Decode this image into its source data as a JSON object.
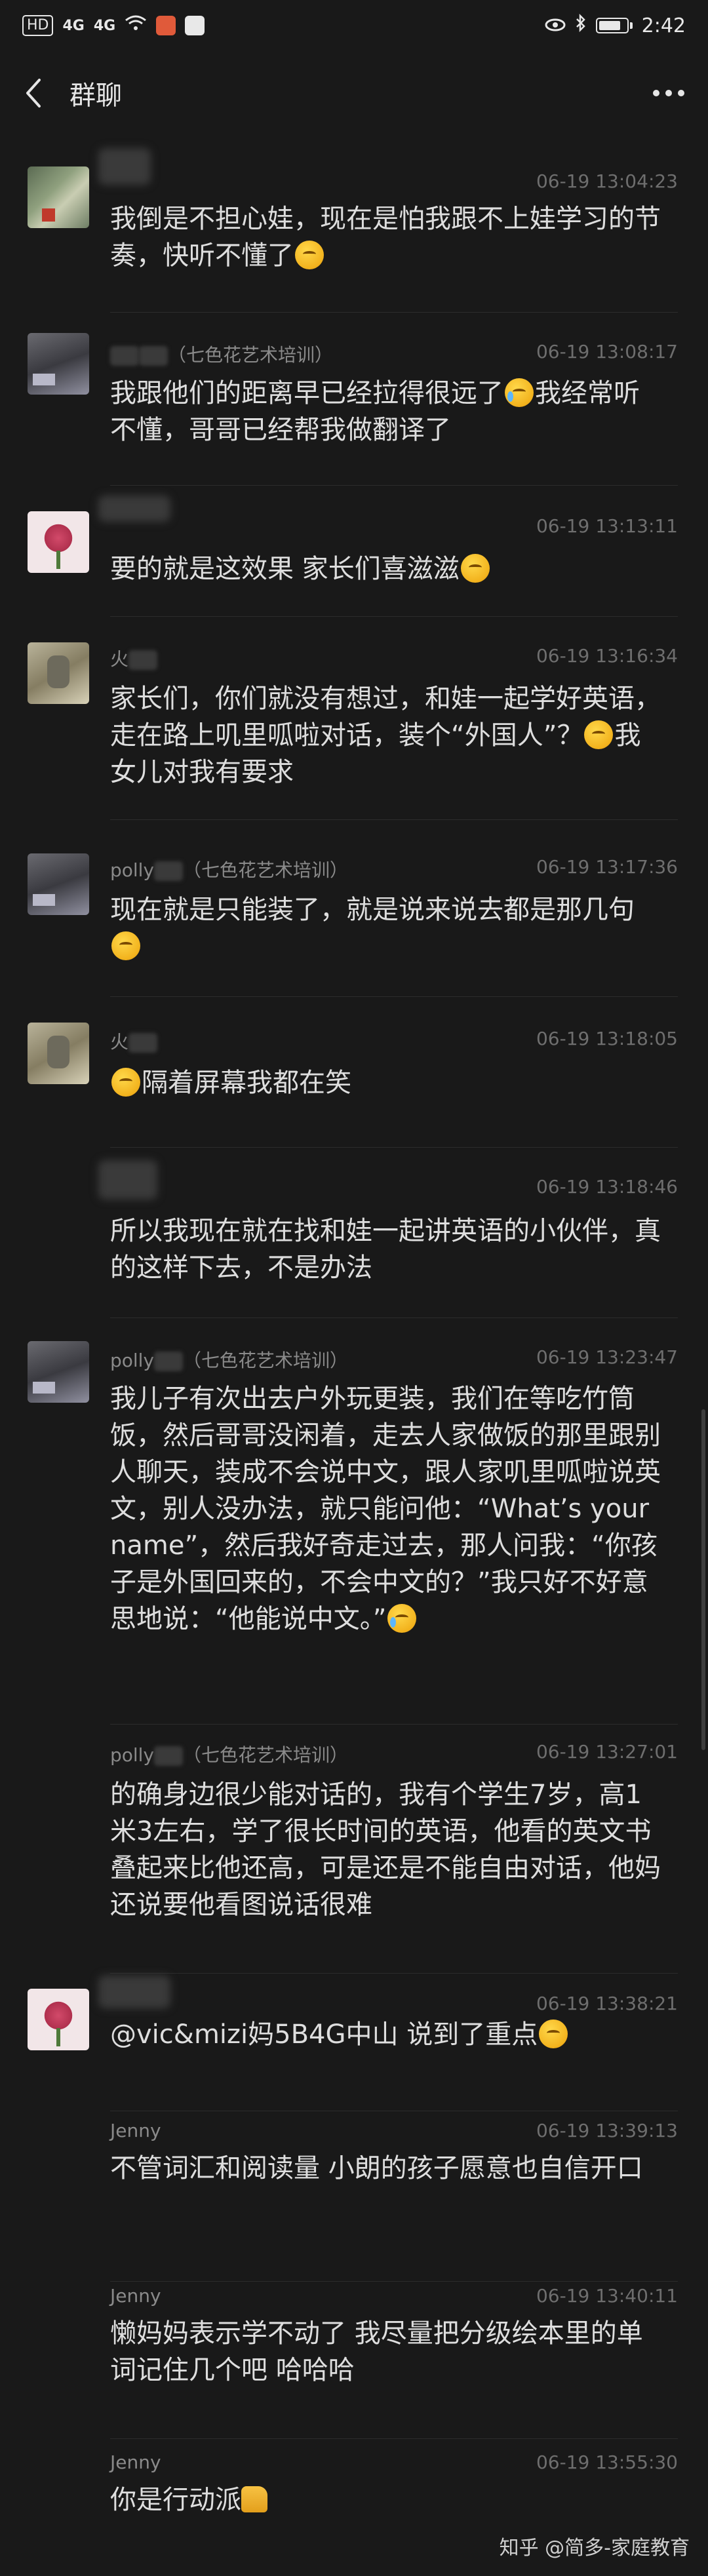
{
  "status": {
    "left_chip": "HD",
    "net1": "4G",
    "net2": "4G",
    "time": "2:42"
  },
  "header": {
    "title": "群聊"
  },
  "messages": [
    {
      "time": "06-19 13:04:23",
      "name": "",
      "text": "我倒是不担心娃，现在是怕我跟不上娃学习的节奏，快听不懂了"
    },
    {
      "time": "06-19 13:08:17",
      "name": "（七色花艺术培训）",
      "text_a": "我跟他们的距离早已经拉得很远了",
      "text_b": "我经常听不懂，哥哥已经帮我做翻译了"
    },
    {
      "time": "06-19 13:13:11",
      "name": "",
      "text": "要的就是这效果 家长们喜滋滋"
    },
    {
      "time": "06-19 13:16:34",
      "name": "火",
      "text_a": "家长们，你们就没有想过，和娃一起学好英语，走在路上叽里呱啦对话，装个“外国人”？",
      "text_b": "我女儿对我有要求"
    },
    {
      "time": "06-19 13:17:36",
      "name": "polly",
      "name_suffix": "（七色花艺术培训）",
      "text": "现在就是只能装了，就是说来说去都是那几句"
    },
    {
      "time": "06-19 13:18:05",
      "name": "火",
      "text": "隔着屏幕我都在笑"
    },
    {
      "time": "06-19 13:18:46",
      "name": "",
      "text": "所以我现在就在找和娃一起讲英语的小伙伴，真的这样下去，不是办法"
    },
    {
      "time": "06-19 13:23:47",
      "name": "polly",
      "name_suffix": "（七色花艺术培训）",
      "text": "我儿子有次出去户外玩更装，我们在等吃竹筒饭，然后哥哥没闲着，走去人家做饭的那里跟别人聊天，装成不会说中文，跟人家叽里呱啦说英文，别人没办法，就只能问他：“What’s your name”，然后我好奇走过去，那人问我：“你孩子是外国回来的，不会中文的？”我只好不好意思地说：“他能说中文。”"
    },
    {
      "time": "06-19 13:27:01",
      "name": "polly",
      "name_suffix": "（七色花艺术培训）",
      "text": "的确身边很少能对话的，我有个学生7岁，高1米3左右，学了很长时间的英语，他看的英文书叠起来比他还高，可是还是不能自由对话，他妈还说要他看图说话很难"
    },
    {
      "time": "06-19 13:38:21",
      "name": "",
      "text": "@vic&mizi妈5B4G中山 说到了重点"
    },
    {
      "time": "06-19 13:39:13",
      "name": "Jenny",
      "text": "不管词汇和阅读量 小朗的孩子愿意也自信开口"
    },
    {
      "time": "06-19 13:40:11",
      "name": "Jenny",
      "text": "懒妈妈表示学不动了 我尽量把分级绘本里的单词记住几个吧 哈哈哈"
    },
    {
      "time": "06-19 13:55:30",
      "name": "Jenny",
      "text": "你是行动派"
    }
  ],
  "watermark": "知乎 @简多-家庭教育",
  "colors": {
    "background": "#191919",
    "text": "#dedede",
    "meta": "#6e6e6e"
  }
}
